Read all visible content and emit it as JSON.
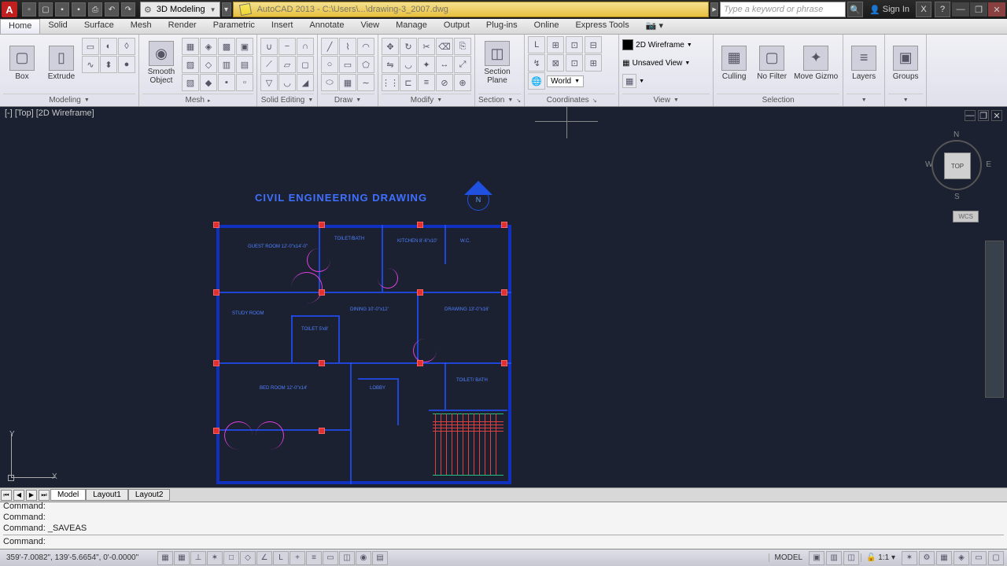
{
  "titlebar": {
    "app_letter": "A",
    "workspace": "3D Modeling",
    "title_path": "AutoCAD 2013 - C:\\Users\\...\\drawing-3_2007.dwg",
    "search_placeholder": "Type a keyword or phrase",
    "signin": "Sign In"
  },
  "tabs": [
    "Home",
    "Solid",
    "Surface",
    "Mesh",
    "Render",
    "Parametric",
    "Insert",
    "Annotate",
    "View",
    "Manage",
    "Output",
    "Plug-ins",
    "Online",
    "Express Tools"
  ],
  "ribbon": {
    "modeling": {
      "box": "Box",
      "extrude": "Extrude",
      "title": "Modeling"
    },
    "mesh": {
      "smooth": "Smooth\nObject",
      "title": "Mesh"
    },
    "solid_editing": {
      "title": "Solid Editing"
    },
    "draw": {
      "title": "Draw"
    },
    "modify": {
      "title": "Modify"
    },
    "section": {
      "plane": "Section\nPlane",
      "title": "Section"
    },
    "coordinates": {
      "world": "World",
      "title": "Coordinates"
    },
    "view": {
      "wire2d": "2D Wireframe",
      "unsaved": "Unsaved View",
      "title": "View"
    },
    "selection": {
      "culling": "Culling",
      "nofilter": "No Filter",
      "movegizmo": "Move Gizmo",
      "title": "Selection"
    },
    "layers": {
      "title": "Layers"
    },
    "groups": {
      "title": "Groups"
    }
  },
  "viewport": {
    "label": "[-] [Top] [2D Wireframe]",
    "drawing_title": "CIVIL ENGINEERING DRAWING",
    "north": "N",
    "ucs_x": "X",
    "ucs_y": "Y",
    "rooms": {
      "guest": "GUEST ROOM\n12'-0\"x14'-0\"",
      "toilet1": "TOILET/BATH",
      "kitchen": "KITCHEN\n8'-6\"x10'",
      "wc": "W.C.",
      "study": "STUDY ROOM",
      "dining": "DINING\n10'-0\"x12'",
      "drawing": "DRAWING\n13'-0\"x16'",
      "toilet2": "TOILET\n5'x8'",
      "bed": "BED ROOM\n12'-0\"x14'",
      "lobby": "LOBBY",
      "toilet3": "TOILET/\nBATH"
    },
    "viewcube": {
      "n": "N",
      "s": "S",
      "e": "E",
      "w": "W",
      "top": "TOP",
      "wcs": "WCS"
    }
  },
  "layout_tabs": [
    "Model",
    "Layout1",
    "Layout2"
  ],
  "command": {
    "l1": "Command:",
    "l2": "Command:",
    "l3": "Command: _SAVEAS",
    "cur": "Command:"
  },
  "status": {
    "coords": "359'-7.0082\", 139'-5.6654\", 0'-0.0000\"",
    "model": "MODEL",
    "scale": "1:1"
  }
}
